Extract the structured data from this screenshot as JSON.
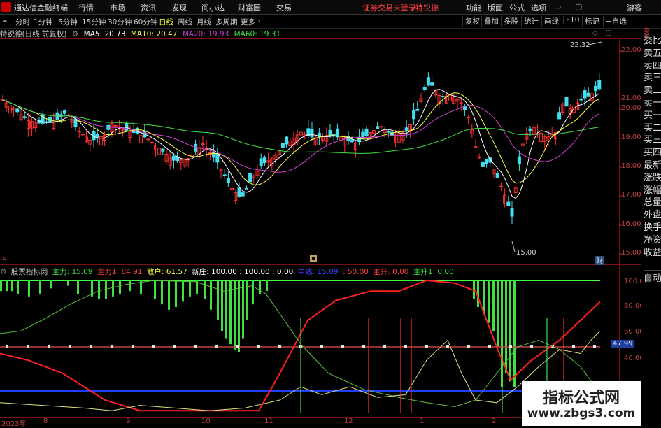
{
  "menubar": {
    "title": "通达信金融终端",
    "items": [
      "行情",
      "市场",
      "资讯",
      "发现",
      "问小达",
      "财富圈",
      "交易"
    ],
    "warning": "证券交易未登录",
    "stock_name": "特锐德",
    "right_items": [
      "功能",
      "版面",
      "公式",
      "选项"
    ],
    "user": "游客"
  },
  "periods": [
    "分时",
    "1分钟",
    "5分钟",
    "15分钟",
    "30分钟",
    "60分钟",
    "日线",
    "周线",
    "月线",
    "多周期",
    "更多"
  ],
  "active_period": "日线",
  "toolbar": [
    "复权",
    "叠加",
    "多股",
    "统计",
    "画线",
    "F10",
    "标记",
    "+自选"
  ],
  "info": {
    "stock": "特锐德(日线 前复权)",
    "ma5": "MA5: 20.73",
    "ma10": "MA10: 20.47",
    "ma20": "MA20: 19.93",
    "ma60": "MA60: 19.31",
    "colors": {
      "ma5": "#ffffff",
      "ma10": "#ffff40",
      "ma20": "#d040d0",
      "ma60": "#40e040"
    }
  },
  "price_annotations": {
    "high": "22.32",
    "low": "15.00",
    "badge": "财"
  },
  "price_axis": [
    "22.00",
    "21.00",
    "20.00",
    "19.00",
    "18.00",
    "17.00",
    "16.00",
    "15.00"
  ],
  "indicator": {
    "name": "股票指标网",
    "items": [
      {
        "label": "主力: 15.09",
        "color": "#40e040"
      },
      {
        "label": "主力1: 84.91",
        "color": "#ff4040"
      },
      {
        "label": "散户: 61.57",
        "color": "#ffff40"
      },
      {
        "label": "新庄: 100.00 : 100.00 : 0.00",
        "color": "#ffffff"
      },
      {
        "label": "中线: 15.09",
        "color": "#4040ff"
      },
      {
        "label": ": 50.00",
        "color": "#ff4040"
      },
      {
        "label": "主升: 0.00",
        "color": "#ff4040"
      },
      {
        "label": "主升1: 0.00",
        "color": "#40e040"
      }
    ]
  },
  "ind_axis": [
    "100.0",
    "80.00",
    "60.00",
    "40.00"
  ],
  "ind_value_badge": "47.99",
  "x_axis": [
    "2023年",
    "8",
    "9",
    "10",
    "11",
    "12",
    "1",
    "2"
  ],
  "side_panel": [
    "委比",
    "卖五",
    "卖四",
    "卖三",
    "卖二",
    "卖一",
    "买一",
    "买二",
    "买三",
    "买四",
    "最新",
    "涨跌",
    "涨幅",
    "总量",
    "外盘",
    "换手",
    "净资",
    "收益"
  ],
  "side_bottom": "自动",
  "side_top": "卖\n卖",
  "watermark": {
    "line1": "指标公式网",
    "line2": "www.zbgs3.com"
  }
}
